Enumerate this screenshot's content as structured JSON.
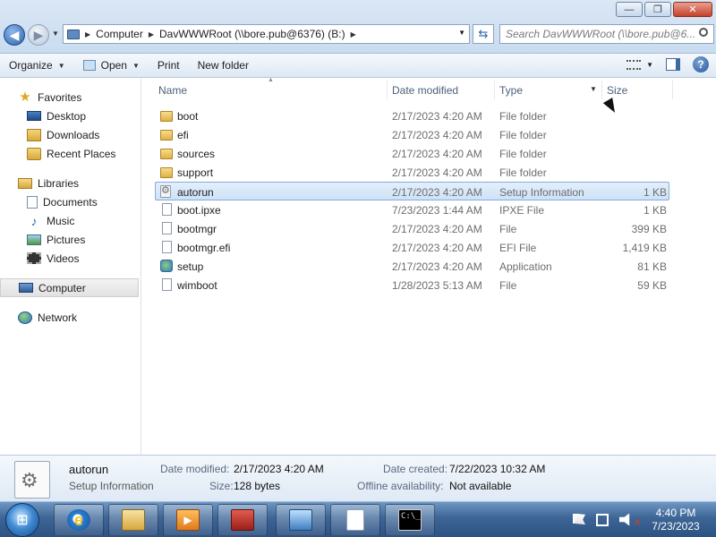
{
  "window": {
    "minimize_glyph": "—",
    "maximize_glyph": "❐",
    "close_glyph": "✕"
  },
  "address": {
    "crumbs": [
      "Computer",
      "DavWWWRoot (\\\\bore.pub@6376) (B:)"
    ],
    "search_placeholder": "Search DavWWWRoot (\\\\bore.pub@6..."
  },
  "toolbar": {
    "organize": "Organize",
    "open": "Open",
    "print": "Print",
    "new_folder": "New folder"
  },
  "nav": {
    "favorites": "Favorites",
    "desktop": "Desktop",
    "downloads": "Downloads",
    "recent_places": "Recent Places",
    "libraries": "Libraries",
    "documents": "Documents",
    "music": "Music",
    "pictures": "Pictures",
    "videos": "Videos",
    "computer": "Computer",
    "network": "Network"
  },
  "columns": {
    "name": "Name",
    "date_modified": "Date modified",
    "type": "Type",
    "size": "Size"
  },
  "files": [
    {
      "name": "boot",
      "date": "2/17/2023 4:20 AM",
      "type": "File folder",
      "size": "",
      "icon": "folder-icon"
    },
    {
      "name": "efi",
      "date": "2/17/2023 4:20 AM",
      "type": "File folder",
      "size": "",
      "icon": "folder-icon"
    },
    {
      "name": "sources",
      "date": "2/17/2023 4:20 AM",
      "type": "File folder",
      "size": "",
      "icon": "folder-icon"
    },
    {
      "name": "support",
      "date": "2/17/2023 4:20 AM",
      "type": "File folder",
      "size": "",
      "icon": "folder-icon"
    },
    {
      "name": "autorun",
      "date": "2/17/2023 4:20 AM",
      "type": "Setup Information",
      "size": "1 KB",
      "icon": "setup-info-icon",
      "selected": true
    },
    {
      "name": "boot.ipxe",
      "date": "7/23/2023 1:44 AM",
      "type": "IPXE File",
      "size": "1 KB",
      "icon": "file-icon"
    },
    {
      "name": "bootmgr",
      "date": "2/17/2023 4:20 AM",
      "type": "File",
      "size": "399 KB",
      "icon": "file-icon"
    },
    {
      "name": "bootmgr.efi",
      "date": "2/17/2023 4:20 AM",
      "type": "EFI File",
      "size": "1,419 KB",
      "icon": "file-icon"
    },
    {
      "name": "setup",
      "date": "2/17/2023 4:20 AM",
      "type": "Application",
      "size": "81 KB",
      "icon": "setup-app-icon"
    },
    {
      "name": "wimboot",
      "date": "1/28/2023 5:13 AM",
      "type": "File",
      "size": "59 KB",
      "icon": "file-icon"
    }
  ],
  "details": {
    "name": "autorun",
    "type": "Setup Information",
    "date_modified_label": "Date modified:",
    "date_modified": "2/17/2023 4:20 AM",
    "size_label": "Size:",
    "size": "128 bytes",
    "date_created_label": "Date created:",
    "date_created": "7/22/2023 10:32 AM",
    "offline_label": "Offline availability:",
    "offline": "Not available"
  },
  "taskbar": {
    "cmd_text": "C:\\_",
    "time": "4:40 PM",
    "date": "7/23/2023"
  },
  "colors": {
    "selection_border": "#84acdd",
    "selection_fill": "#cde2f7",
    "taskbar": "#3d6595"
  }
}
